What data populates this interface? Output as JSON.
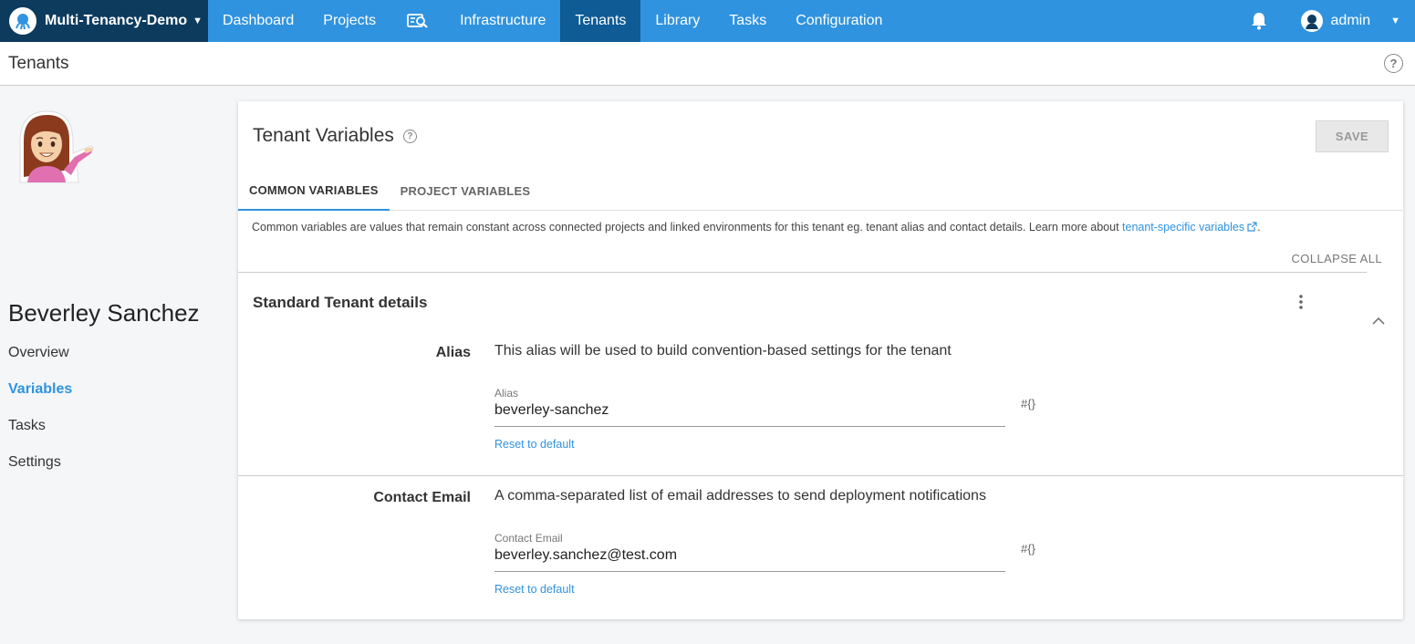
{
  "topnav": {
    "space_name": "Multi-Tenancy-Demo",
    "items": [
      {
        "label": "Dashboard"
      },
      {
        "label": "Projects"
      },
      {
        "label": "Infrastructure"
      },
      {
        "label": "Tenants"
      },
      {
        "label": "Library"
      },
      {
        "label": "Tasks"
      },
      {
        "label": "Configuration"
      }
    ],
    "active_item": "Tenants",
    "user": "admin",
    "brand_color": "#2f93e0",
    "active_color": "#0f5b96",
    "space_color": "#0d3b5e"
  },
  "pageheader": {
    "title": "Tenants",
    "help": "?"
  },
  "tenant": {
    "name": "Beverley Sanchez",
    "nav": [
      "Overview",
      "Variables",
      "Tasks",
      "Settings"
    ],
    "active_nav": "Variables"
  },
  "card": {
    "title": "Tenant Variables",
    "title_help": "?",
    "save_label": "SAVE",
    "tabs": [
      "COMMON VARIABLES",
      "PROJECT VARIABLES"
    ],
    "active_tab": "COMMON VARIABLES",
    "description": "Common variables are values that remain constant across connected projects and linked environments for this tenant eg. tenant alias and contact details. Learn more about ",
    "description_link": "tenant-specific variables",
    "description_end": ".",
    "collapse_all": "COLLAPSE ALL",
    "section_title": "Standard Tenant details",
    "fields": [
      {
        "label": "Alias",
        "description": "This alias will be used to build convention-based settings for the tenant",
        "input_label": "Alias",
        "value": "beverley-sanchez",
        "bind": "#{}",
        "reset": "Reset to default"
      },
      {
        "label": "Contact Email",
        "description": "A comma-separated list of email addresses to send deployment notifications",
        "input_label": "Contact Email",
        "value": "beverley.sanchez@test.com",
        "bind": "#{}",
        "reset": "Reset to default"
      }
    ]
  }
}
